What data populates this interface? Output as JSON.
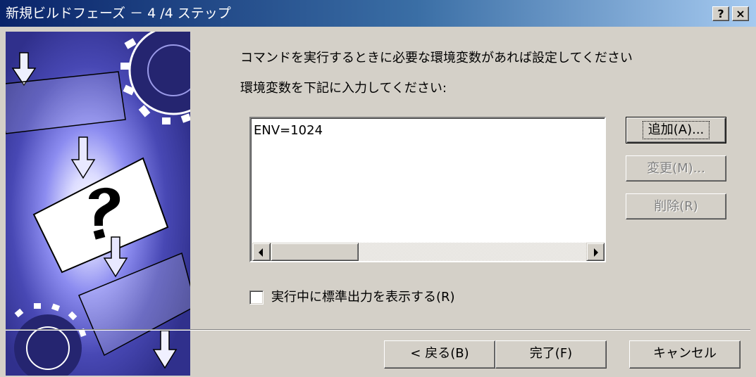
{
  "window": {
    "title": "新規ビルドフェーズ － 4 /4 ステップ",
    "help_label": "?",
    "close_label": "×"
  },
  "main": {
    "description": "コマンドを実行するときに必要な環境変数があれば設定してください",
    "prompt": "環境変数を下記に入力してください:",
    "env_list": [
      "ENV=1024"
    ]
  },
  "buttons": {
    "add": "追加(A)...",
    "edit": "変更(M)...",
    "delete": "削除(R)"
  },
  "checkbox": {
    "label": "実行中に標準出力を表示する(R)",
    "checked": false
  },
  "footer": {
    "back": "< 戻る(B)",
    "finish": "完了(F)",
    "cancel": "キャンセル"
  },
  "colors": {
    "titlebar_start": "#0a246a",
    "titlebar_end": "#a6caf0",
    "dialog_bg": "#d4d0c8",
    "disabled_text": "#808080"
  }
}
